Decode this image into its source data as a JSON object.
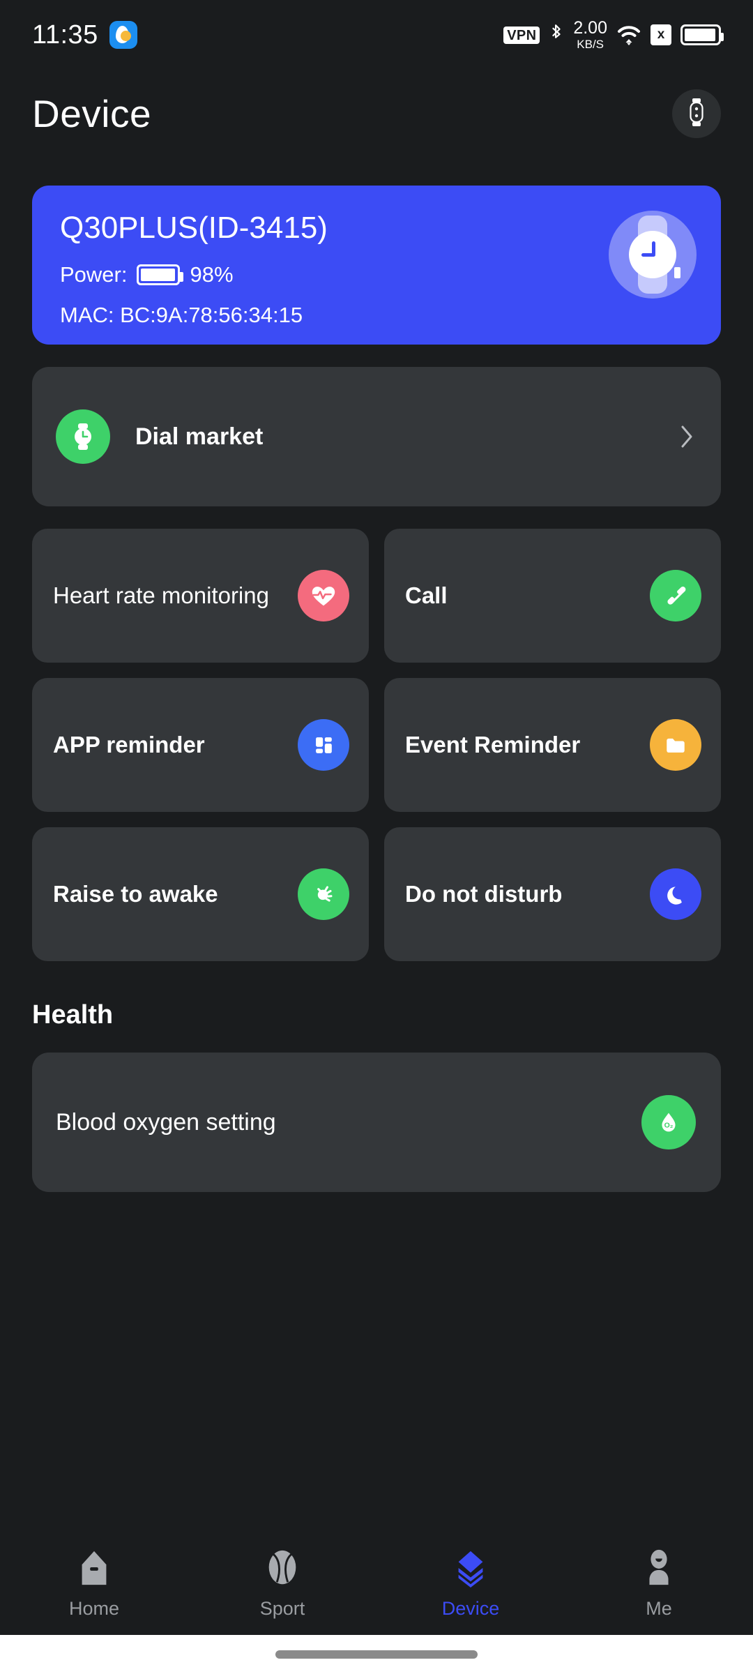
{
  "status_bar": {
    "time": "11:35",
    "weather_icon": "weather-partly-cloudy-icon",
    "vpn_label": "VPN",
    "bluetooth_icon": "bluetooth-icon",
    "network_speed_value": "2.00",
    "network_speed_unit": "KB/S",
    "wifi_icon": "wifi-icon",
    "sim_label": "x",
    "battery_icon": "battery-full-icon",
    "battery_level_pct": 95
  },
  "header": {
    "title": "Device",
    "watch_button_icon": "smartwatch-icon"
  },
  "device_card": {
    "name": "Q30PLUS(ID-3415)",
    "power_label": "Power:",
    "power_value": "98%",
    "power_level_pct": 98,
    "mac_text": "MAC: BC:9A:78:56:34:15",
    "illustration_icon": "watch-clock-icon",
    "accent_color": "#3c4cf5"
  },
  "dial_market": {
    "label": "Dial market",
    "icon": "watch-dial-icon",
    "icon_color": "#3ed169",
    "chevron_icon": "chevron-right-icon"
  },
  "tiles": [
    {
      "label": "Heart rate monitoring",
      "icon": "heart-pulse-icon",
      "icon_color": "#f46b7e"
    },
    {
      "label": "Call",
      "icon": "phone-icon",
      "icon_color": "#3ed169"
    },
    {
      "label": "APP reminder",
      "icon": "apps-grid-icon",
      "icon_color": "#3c6df5"
    },
    {
      "label": "Event Reminder",
      "icon": "folder-icon",
      "icon_color": "#f6b33b"
    },
    {
      "label": "Raise to awake",
      "icon": "brightness-icon",
      "icon_color": "#3ed169"
    },
    {
      "label": "Do not disturb",
      "icon": "moon-icon",
      "icon_color": "#3c4cf5"
    }
  ],
  "health": {
    "section_title": "Health",
    "blood_oxygen": {
      "label": "Blood oxygen setting",
      "icon": "blood-oxygen-icon",
      "icon_color": "#3ed169"
    }
  },
  "bottom_nav": {
    "active_color": "#3c4cf5",
    "items": [
      {
        "label": "Home",
        "icon": "home-icon",
        "active": false
      },
      {
        "label": "Sport",
        "icon": "sport-ball-icon",
        "active": false
      },
      {
        "label": "Device",
        "icon": "layers-icon",
        "active": true
      },
      {
        "label": "Me",
        "icon": "person-icon",
        "active": false
      }
    ]
  }
}
